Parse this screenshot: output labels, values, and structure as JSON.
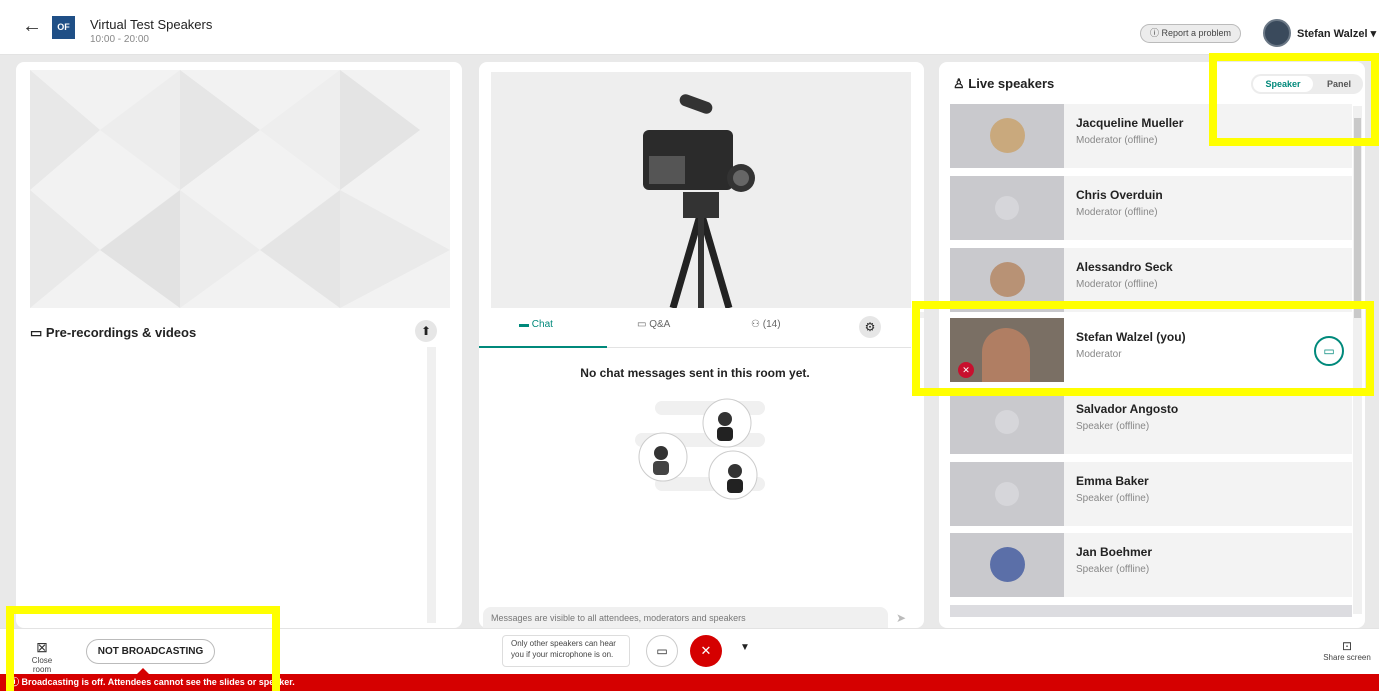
{
  "header": {
    "back_icon": "arrow-left-icon",
    "logo_text": "OF",
    "title": "Virtual Test Speakers",
    "time": "10:00 - 20:00",
    "report_label": "Report a problem",
    "user_name": "Stefan Walzel"
  },
  "left": {
    "section_title": "Pre-recordings & videos"
  },
  "center": {
    "tabs": {
      "chat": "Chat",
      "qa": "Q&A",
      "people": "(14)"
    },
    "empty_text": "No chat messages sent in this room yet.",
    "input_placeholder": "Messages are visible to all attendees, moderators and speakers"
  },
  "right": {
    "title": "Live speakers",
    "toggle": {
      "speaker": "Speaker",
      "panel": "Panel",
      "active": "Speaker"
    },
    "speakers": [
      {
        "name": "Jacqueline Mueller",
        "role": "Moderator (offline)"
      },
      {
        "name": "Chris Overduin",
        "role": "Moderator (offline)"
      },
      {
        "name": "Alessandro Seck",
        "role": "Moderator (offline)"
      },
      {
        "name": "Stefan Walzel (you)",
        "role": "Moderator"
      },
      {
        "name": "Salvador Angosto",
        "role": "Speaker (offline)"
      },
      {
        "name": "Emma Baker",
        "role": "Speaker (offline)"
      },
      {
        "name": "Jan Boehmer",
        "role": "Speaker (offline)"
      }
    ]
  },
  "bottom": {
    "close_room": "Close room",
    "broadcast_label": "NOT BROADCASTING",
    "mic_hint": "Only other speakers can hear you if your microphone is on.",
    "share_screen": "Share screen",
    "banner": "Broadcasting is off. Attendees cannot see the slides or speaker."
  },
  "colors": {
    "accent": "#00897b",
    "alert": "#d50000",
    "highlight": "#ffff00"
  }
}
